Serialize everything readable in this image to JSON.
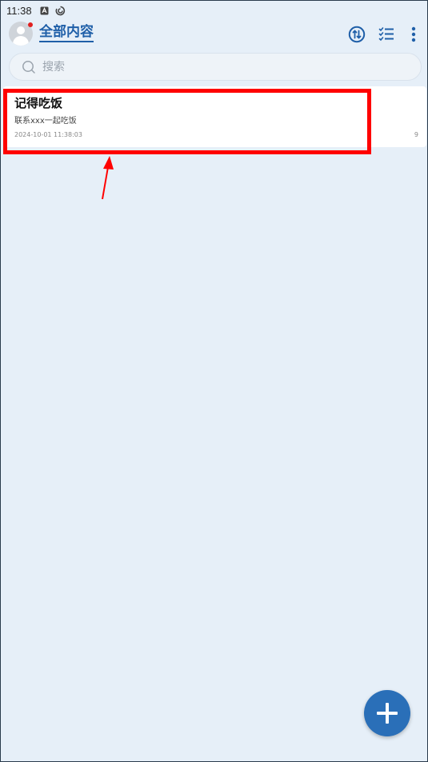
{
  "status_bar": {
    "time": "11:38",
    "icons": [
      "app-notification-icon",
      "sync-notification-icon"
    ]
  },
  "header": {
    "title": "全部内容",
    "icons": [
      "avatar",
      "sort-icon",
      "checklist-icon",
      "more-vert-icon"
    ]
  },
  "search": {
    "placeholder": "搜索",
    "value": ""
  },
  "notes": [
    {
      "title": "记得吃饭",
      "body": "联系xxx一起吃饭",
      "timestamp": "2024-10-01 11:38:03",
      "count": "9"
    }
  ],
  "fab": {
    "icon": "plus-icon"
  },
  "colors": {
    "accent": "#1f5fa8",
    "background": "#e6eff8",
    "fab": "#2a6fb8",
    "highlight": "#ff0000"
  }
}
